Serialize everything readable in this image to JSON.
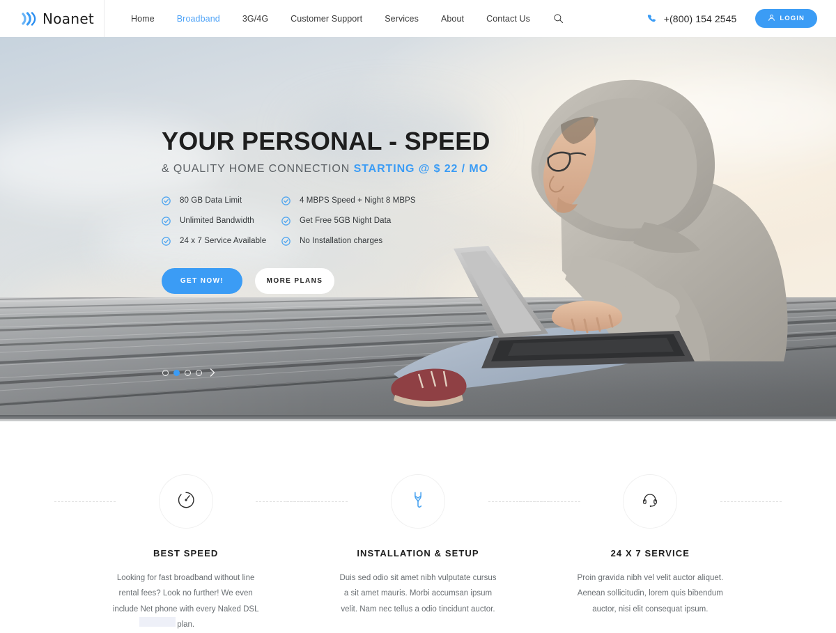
{
  "header": {
    "logo": {
      "text": "Noanet",
      "icon": "signal-wave-icon",
      "color": "#3b9cf5"
    },
    "nav": [
      {
        "label": "Home",
        "active": false
      },
      {
        "label": "Broadband",
        "active": true
      },
      {
        "label": "3G/4G",
        "active": false
      },
      {
        "label": "Customer Support",
        "active": false
      },
      {
        "label": "Services",
        "active": false
      },
      {
        "label": "About",
        "active": false
      },
      {
        "label": "Contact Us",
        "active": false
      }
    ],
    "search_icon": "search-icon",
    "phone": {
      "icon": "phone-icon",
      "number": "+(800) 154 2545"
    },
    "login": {
      "label": "LOGIN",
      "icon": "user-icon"
    }
  },
  "hero": {
    "title": "YOUR PERSONAL - SPEED",
    "subtitle_plain": "& QUALITY HOME CONNECTION ",
    "subtitle_highlight": "STARTING @ $ 22 / MO",
    "features": [
      "80 GB Data Limit",
      "4 MBPS Speed + Night 8 MBPS",
      "Unlimited Bandwidth",
      "Get Free 5GB Night Data",
      "24 x 7 Service Available",
      "No Installation charges"
    ],
    "primary_button": "GET NOW!",
    "secondary_button": "MORE PLANS",
    "carousel": {
      "total_dots": 4,
      "active_index": 1,
      "next_icon": "chevron-right-icon"
    },
    "image_alt": "man in grey hoodie using laptop on wooden deck"
  },
  "services": [
    {
      "icon": "speedometer-icon",
      "title": "BEST SPEED",
      "desc": "Looking for fast broadband without line rental fees? Look no further! We even include Net phone with every Naked DSL plan."
    },
    {
      "icon": "wrench-icon",
      "title": "INSTALLATION & SETUP",
      "desc": "Duis sed odio sit amet nibh vulputate cursus a sit amet mauris. Morbi accumsan ipsum velit. Nam nec tellus a odio tincidunt auctor."
    },
    {
      "icon": "headset-icon",
      "title": "24 X 7 SERVICE",
      "desc": "Proin gravida nibh vel velit auctor aliquet. Aenean sollicitudin, lorem quis bibendum auctor, nisi elit consequat ipsum."
    }
  ],
  "colors": {
    "accent": "#3b9cf5",
    "nav_active": "#4fa3f7",
    "text_dark": "#1e1e1e",
    "text_muted": "#6a6f73"
  }
}
